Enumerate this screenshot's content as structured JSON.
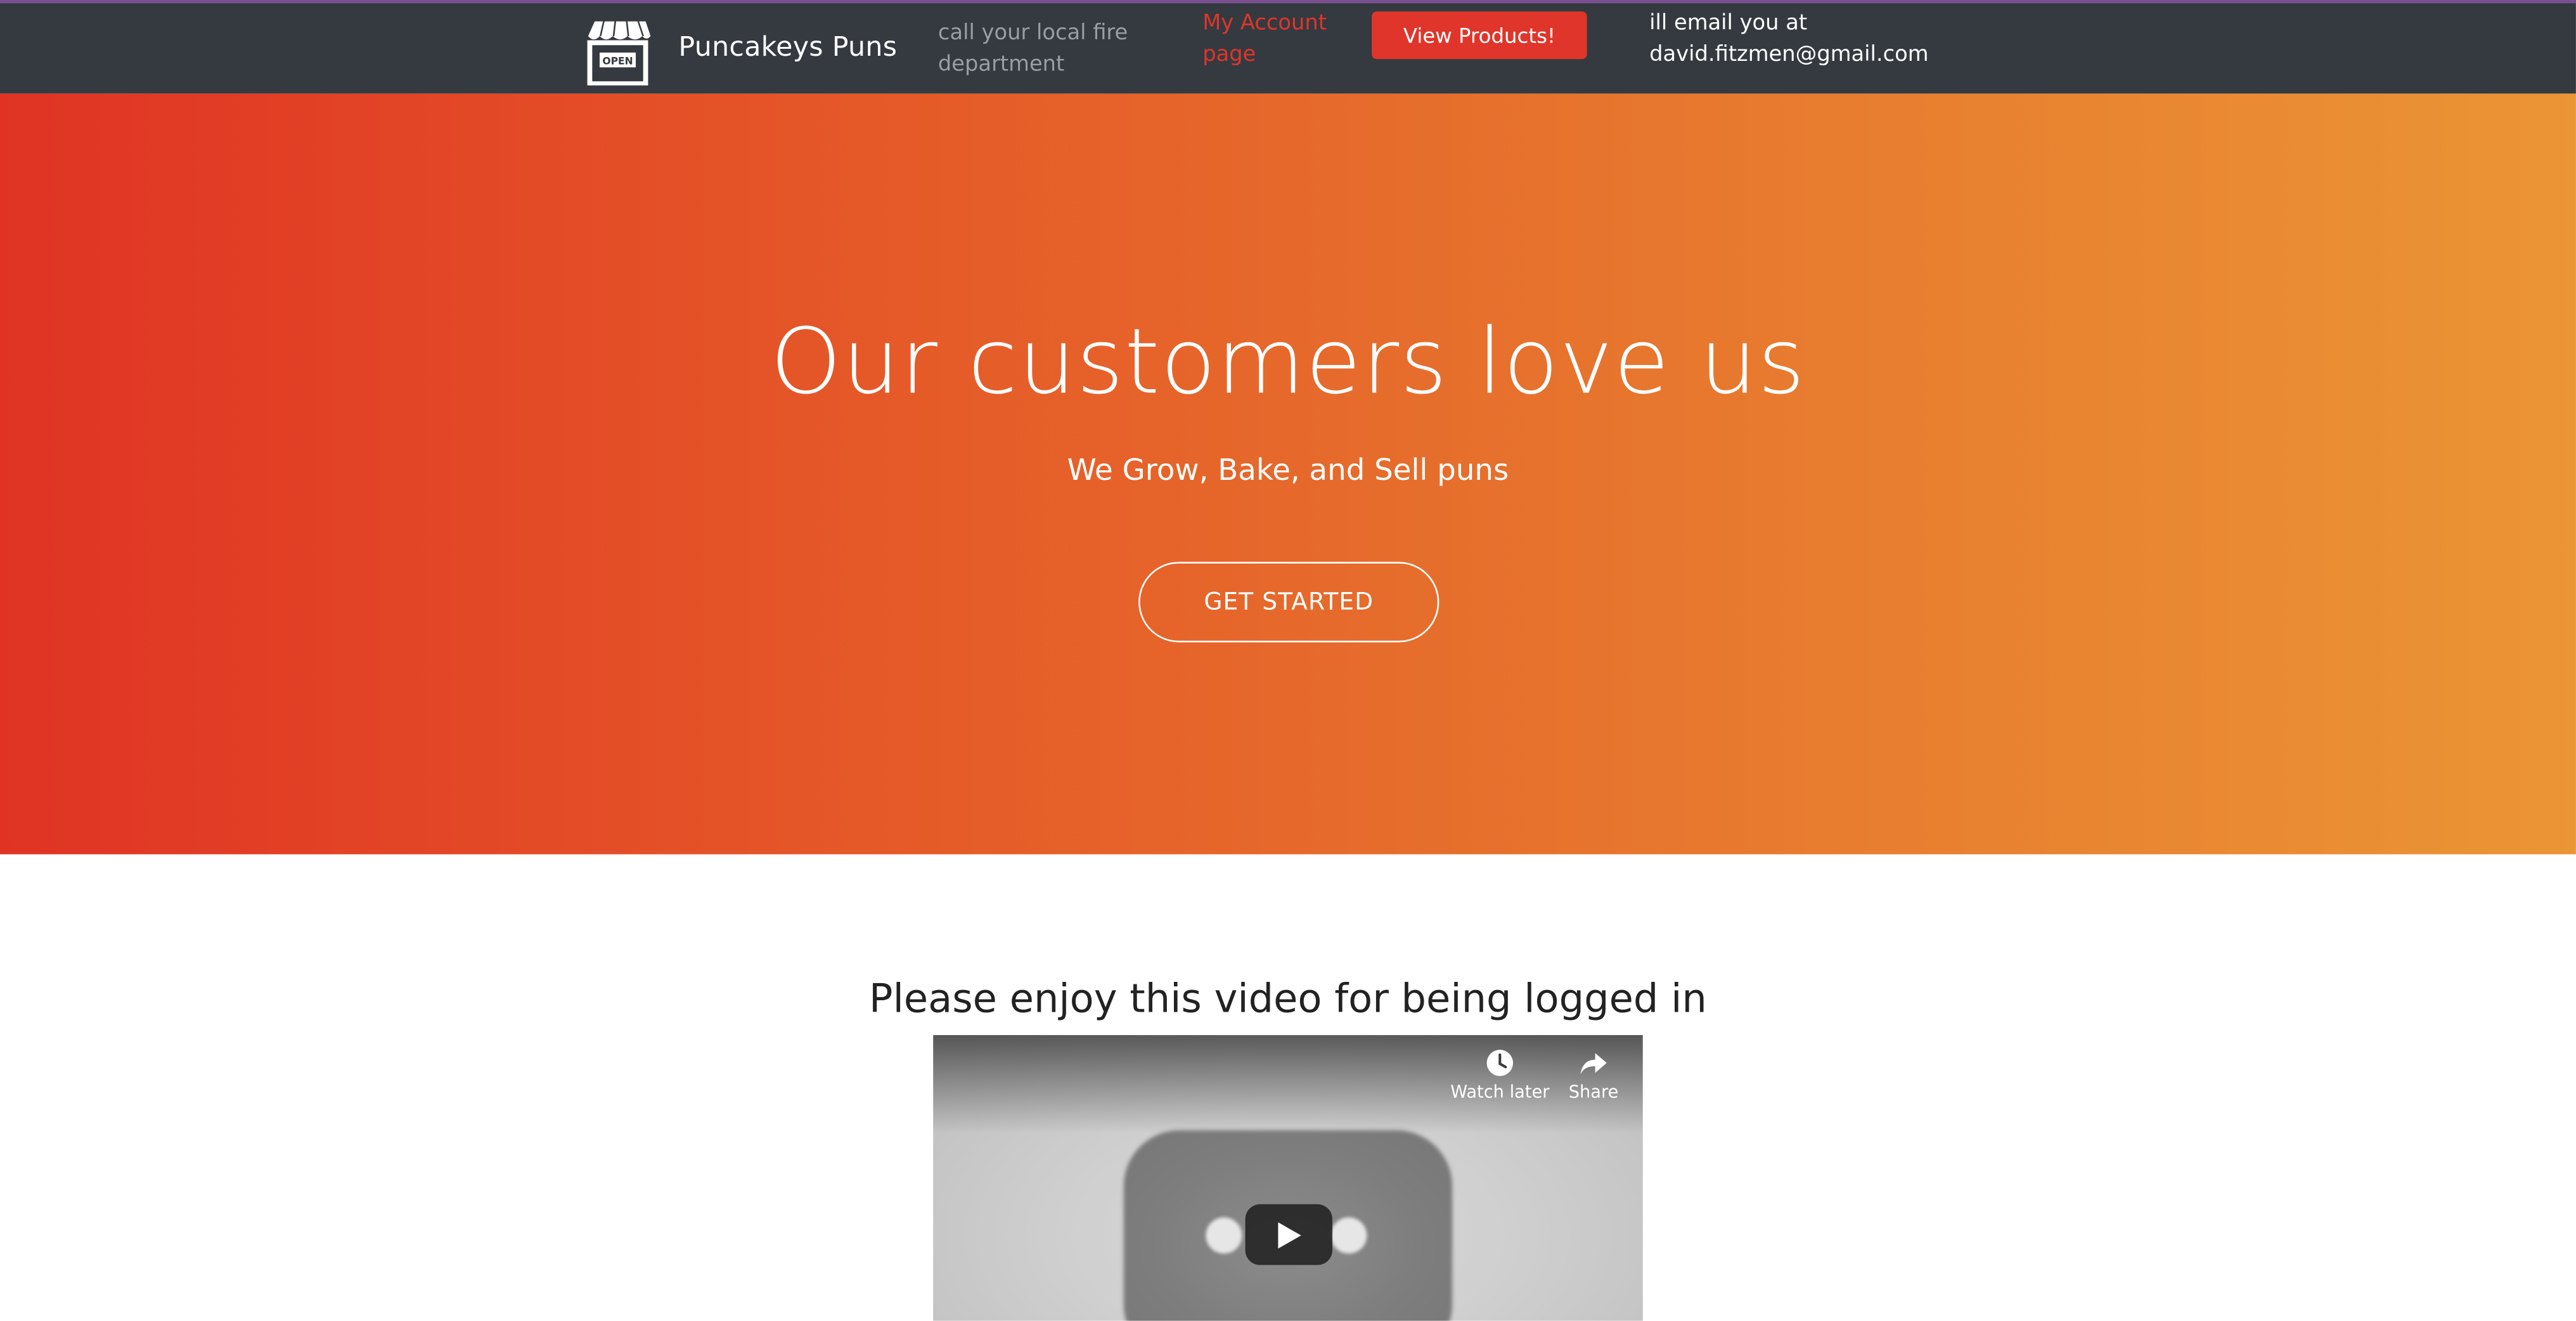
{
  "navbar": {
    "logo_icon": "storefront-open-icon",
    "logo_sign_text": "OPEN",
    "brand": "Puncakeys Puns",
    "tagline": "call your local fire department",
    "account_link": "My Account page",
    "products_button": "View Products!",
    "email_note": "ill email you at david.fitzmen@gmail.com",
    "colors": {
      "background": "#343a40",
      "accent": "#e0352b"
    }
  },
  "hero": {
    "title": "Our customers love us",
    "subtitle": "We Grow, Bake, and Sell puns",
    "cta_button": "GET STARTED",
    "gradient": [
      "#e03324",
      "#eb9535"
    ]
  },
  "video_section": {
    "heading": "Please enjoy this video for being logged in",
    "video": {
      "watch_later_icon": "clock-icon",
      "watch_later_label": "Watch later",
      "share_icon": "share-arrow-icon",
      "share_label": "Share",
      "play_icon": "play-icon"
    }
  }
}
